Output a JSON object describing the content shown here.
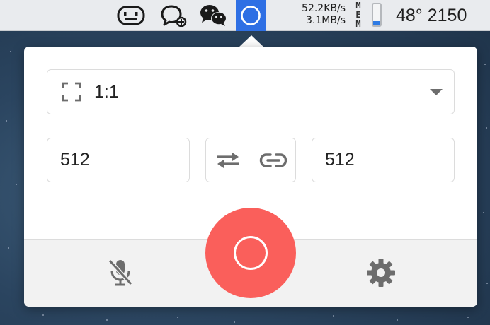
{
  "menubar": {
    "icons": [
      "face-icon",
      "chat-bubble-icon",
      "wechat-icon",
      "record-circle-icon"
    ],
    "net_upload": "52.2KB/s",
    "net_download": "3.1MB/s",
    "mem_label_1": "M",
    "mem_label_2": "E",
    "mem_label_3": "M",
    "mem_fraction": 0.2,
    "temperature_text": "48° 2150",
    "active_color": "#2e6fe4"
  },
  "popover": {
    "aspect_ratio": "1:1",
    "width_value": "512",
    "height_value": "512",
    "record_color": "#fa5f5b",
    "controls": {
      "swap_icon": "swap-arrows-icon",
      "link_icon": "link-icon",
      "mic_icon": "microphone-muted-icon",
      "settings_icon": "gear-icon",
      "record_icon": "record-circle-icon",
      "ratio_icon": "crop-frame-icon"
    }
  }
}
